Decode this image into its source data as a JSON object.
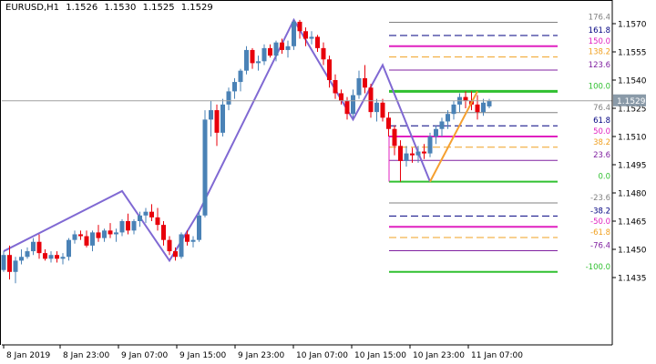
{
  "header": {
    "symbol": "EURUSD,H1",
    "open": "1.1526",
    "high": "1.1530",
    "low": "1.1525",
    "close": "1.1529"
  },
  "colors": {
    "bull": "#4a82b6",
    "bear": "#e8000b",
    "zigzag": "#8069d3",
    "trend": "#f5a030",
    "price_line": "#a0a0a0",
    "level_gray": "#808080",
    "level_navy": "#000080",
    "level_magenta": "#e020c0",
    "level_orange": "#f0a020",
    "level_green": "#30c030",
    "level_purple": "#8020a0",
    "axis": "#000000",
    "price_box": "#8a9aa8"
  },
  "chart_data": {
    "type": "candlestick",
    "symbol": "EURUSD",
    "timeframe": "H1",
    "ylim": [
      1.1432,
      1.1581
    ],
    "y_ticks": [
      "1.1570",
      "1.1555",
      "1.1540",
      "1.1525",
      "1.1510",
      "1.1495",
      "1.1480",
      "1.1465",
      "1.1450",
      "1.1435"
    ],
    "x_ticks": [
      "8 Jan 2019",
      "8 Jan 23:00",
      "9 Jan 07:00",
      "9 Jan 15:00",
      "9 Jan 23:00",
      "10 Jan 07:00",
      "10 Jan 15:00",
      "10 Jan 23:00",
      "11 Jan 07:00"
    ],
    "current_price": "1.1529",
    "candles": [
      {
        "o": 1.1439,
        "h": 1.1449,
        "l": 1.1438,
        "c": 1.1447
      },
      {
        "o": 1.1447,
        "h": 1.1452,
        "l": 1.1434,
        "c": 1.1438
      },
      {
        "o": 1.1438,
        "h": 1.1446,
        "l": 1.1432,
        "c": 1.1444
      },
      {
        "o": 1.1444,
        "h": 1.145,
        "l": 1.1442,
        "c": 1.1446
      },
      {
        "o": 1.1446,
        "h": 1.1451,
        "l": 1.1445,
        "c": 1.1449
      },
      {
        "o": 1.1449,
        "h": 1.1456,
        "l": 1.1447,
        "c": 1.1454
      },
      {
        "o": 1.1454,
        "h": 1.1458,
        "l": 1.1445,
        "c": 1.1448
      },
      {
        "o": 1.1448,
        "h": 1.145,
        "l": 1.1444,
        "c": 1.1445
      },
      {
        "o": 1.1445,
        "h": 1.1449,
        "l": 1.1443,
        "c": 1.1447
      },
      {
        "o": 1.1447,
        "h": 1.1449,
        "l": 1.1443,
        "c": 1.1445
      },
      {
        "o": 1.1445,
        "h": 1.1448,
        "l": 1.1442,
        "c": 1.1446
      },
      {
        "o": 1.1446,
        "h": 1.1456,
        "l": 1.1444,
        "c": 1.1455
      },
      {
        "o": 1.1455,
        "h": 1.146,
        "l": 1.1453,
        "c": 1.1458
      },
      {
        "o": 1.1458,
        "h": 1.146,
        "l": 1.1455,
        "c": 1.1457
      },
      {
        "o": 1.1457,
        "h": 1.146,
        "l": 1.1451,
        "c": 1.1452
      },
      {
        "o": 1.1452,
        "h": 1.146,
        "l": 1.1449,
        "c": 1.1459
      },
      {
        "o": 1.1459,
        "h": 1.1463,
        "l": 1.1454,
        "c": 1.1456
      },
      {
        "o": 1.1456,
        "h": 1.1461,
        "l": 1.1454,
        "c": 1.146
      },
      {
        "o": 1.146,
        "h": 1.1464,
        "l": 1.1456,
        "c": 1.1458
      },
      {
        "o": 1.1458,
        "h": 1.1461,
        "l": 1.1454,
        "c": 1.1459
      },
      {
        "o": 1.1459,
        "h": 1.1466,
        "l": 1.1457,
        "c": 1.1465
      },
      {
        "o": 1.1465,
        "h": 1.1469,
        "l": 1.1458,
        "c": 1.146
      },
      {
        "o": 1.146,
        "h": 1.1466,
        "l": 1.1458,
        "c": 1.1465
      },
      {
        "o": 1.1465,
        "h": 1.147,
        "l": 1.1462,
        "c": 1.1468
      },
      {
        "o": 1.1468,
        "h": 1.1472,
        "l": 1.1464,
        "c": 1.147
      },
      {
        "o": 1.147,
        "h": 1.1474,
        "l": 1.1465,
        "c": 1.1467
      },
      {
        "o": 1.1467,
        "h": 1.1472,
        "l": 1.146,
        "c": 1.1463
      },
      {
        "o": 1.1463,
        "h": 1.1465,
        "l": 1.1452,
        "c": 1.1455
      },
      {
        "o": 1.1455,
        "h": 1.1457,
        "l": 1.1447,
        "c": 1.1449
      },
      {
        "o": 1.1449,
        "h": 1.1451,
        "l": 1.1444,
        "c": 1.1446
      },
      {
        "o": 1.1446,
        "h": 1.1459,
        "l": 1.1445,
        "c": 1.1458
      },
      {
        "o": 1.1458,
        "h": 1.146,
        "l": 1.1452,
        "c": 1.1454
      },
      {
        "o": 1.1454,
        "h": 1.1457,
        "l": 1.1451,
        "c": 1.1455
      },
      {
        "o": 1.1455,
        "h": 1.147,
        "l": 1.1454,
        "c": 1.1468
      },
      {
        "o": 1.1468,
        "h": 1.1524,
        "l": 1.1467,
        "c": 1.1519
      },
      {
        "o": 1.1519,
        "h": 1.1529,
        "l": 1.151,
        "c": 1.1524
      },
      {
        "o": 1.1524,
        "h": 1.1527,
        "l": 1.1505,
        "c": 1.1512
      },
      {
        "o": 1.1512,
        "h": 1.153,
        "l": 1.151,
        "c": 1.1527
      },
      {
        "o": 1.1527,
        "h": 1.1536,
        "l": 1.1524,
        "c": 1.1534
      },
      {
        "o": 1.1534,
        "h": 1.1541,
        "l": 1.153,
        "c": 1.1539
      },
      {
        "o": 1.1539,
        "h": 1.1546,
        "l": 1.1534,
        "c": 1.1545
      },
      {
        "o": 1.1545,
        "h": 1.1558,
        "l": 1.1543,
        "c": 1.1556
      },
      {
        "o": 1.1556,
        "h": 1.1557,
        "l": 1.1546,
        "c": 1.1549
      },
      {
        "o": 1.1549,
        "h": 1.1553,
        "l": 1.1545,
        "c": 1.155
      },
      {
        "o": 1.155,
        "h": 1.1559,
        "l": 1.1548,
        "c": 1.1557
      },
      {
        "o": 1.1557,
        "h": 1.1559,
        "l": 1.1552,
        "c": 1.1553
      },
      {
        "o": 1.1553,
        "h": 1.1561,
        "l": 1.155,
        "c": 1.156
      },
      {
        "o": 1.156,
        "h": 1.1562,
        "l": 1.1554,
        "c": 1.1556
      },
      {
        "o": 1.1556,
        "h": 1.1561,
        "l": 1.1552,
        "c": 1.1558
      },
      {
        "o": 1.1558,
        "h": 1.1572,
        "l": 1.1556,
        "c": 1.1571
      },
      {
        "o": 1.1571,
        "h": 1.1572,
        "l": 1.1562,
        "c": 1.1566
      },
      {
        "o": 1.1566,
        "h": 1.1568,
        "l": 1.1558,
        "c": 1.1562
      },
      {
        "o": 1.1562,
        "h": 1.1566,
        "l": 1.1559,
        "c": 1.1563
      },
      {
        "o": 1.1563,
        "h": 1.1564,
        "l": 1.1555,
        "c": 1.1557
      },
      {
        "o": 1.1557,
        "h": 1.156,
        "l": 1.1548,
        "c": 1.1551
      },
      {
        "o": 1.1551,
        "h": 1.1553,
        "l": 1.1536,
        "c": 1.154
      },
      {
        "o": 1.154,
        "h": 1.1543,
        "l": 1.153,
        "c": 1.1533
      },
      {
        "o": 1.1533,
        "h": 1.1535,
        "l": 1.1527,
        "c": 1.1529
      },
      {
        "o": 1.1529,
        "h": 1.1531,
        "l": 1.1519,
        "c": 1.1522
      },
      {
        "o": 1.1522,
        "h": 1.1535,
        "l": 1.152,
        "c": 1.1532
      },
      {
        "o": 1.1532,
        "h": 1.1545,
        "l": 1.153,
        "c": 1.1541
      },
      {
        "o": 1.1541,
        "h": 1.1548,
        "l": 1.1533,
        "c": 1.1536
      },
      {
        "o": 1.1536,
        "h": 1.1538,
        "l": 1.152,
        "c": 1.1523
      },
      {
        "o": 1.1523,
        "h": 1.153,
        "l": 1.1518,
        "c": 1.1528
      },
      {
        "o": 1.1528,
        "h": 1.153,
        "l": 1.1518,
        "c": 1.152
      },
      {
        "o": 1.152,
        "h": 1.1523,
        "l": 1.151,
        "c": 1.1514
      },
      {
        "o": 1.1514,
        "h": 1.1516,
        "l": 1.15,
        "c": 1.1505
      },
      {
        "o": 1.1505,
        "h": 1.1508,
        "l": 1.1486,
        "c": 1.1497
      },
      {
        "o": 1.1497,
        "h": 1.1505,
        "l": 1.1494,
        "c": 1.1501
      },
      {
        "o": 1.1501,
        "h": 1.1504,
        "l": 1.1496,
        "c": 1.15
      },
      {
        "o": 1.15,
        "h": 1.1505,
        "l": 1.1496,
        "c": 1.1502
      },
      {
        "o": 1.1502,
        "h": 1.1506,
        "l": 1.1498,
        "c": 1.1501
      },
      {
        "o": 1.1501,
        "h": 1.1512,
        "l": 1.1499,
        "c": 1.151
      },
      {
        "o": 1.151,
        "h": 1.1516,
        "l": 1.1506,
        "c": 1.1514
      },
      {
        "o": 1.1514,
        "h": 1.152,
        "l": 1.151,
        "c": 1.1518
      },
      {
        "o": 1.1518,
        "h": 1.1524,
        "l": 1.1514,
        "c": 1.1522
      },
      {
        "o": 1.1522,
        "h": 1.1529,
        "l": 1.1519,
        "c": 1.1527
      },
      {
        "o": 1.1527,
        "h": 1.1533,
        "l": 1.1523,
        "c": 1.1531
      },
      {
        "o": 1.1531,
        "h": 1.1534,
        "l": 1.1525,
        "c": 1.1529
      },
      {
        "o": 1.1529,
        "h": 1.1534,
        "l": 1.1524,
        "c": 1.1527
      },
      {
        "o": 1.1527,
        "h": 1.1532,
        "l": 1.1519,
        "c": 1.1523
      },
      {
        "o": 1.1523,
        "h": 1.153,
        "l": 1.1521,
        "c": 1.1528
      },
      {
        "o": 1.1526,
        "h": 1.153,
        "l": 1.1525,
        "c": 1.1529
      }
    ],
    "zigzag": [
      {
        "i": 0,
        "p": 1.1449
      },
      {
        "i": 20,
        "p": 1.1481
      },
      {
        "i": 28,
        "p": 1.1444
      },
      {
        "i": 33,
        "p": 1.147
      },
      {
        "i": 49,
        "p": 1.1572
      },
      {
        "i": 59,
        "p": 1.1519
      },
      {
        "i": 64,
        "p": 1.1548
      },
      {
        "i": 72,
        "p": 1.1486
      }
    ],
    "trendline": [
      {
        "i": 72,
        "p": 1.1486
      },
      {
        "i": 80,
        "p": 1.1534
      }
    ],
    "fib_levels": [
      {
        "label": "176.4",
        "price": 1.15707,
        "color": "#808080",
        "style": "solid",
        "width": 1
      },
      {
        "label": "161.8",
        "price": 1.15637,
        "color": "#000080",
        "style": "dash",
        "width": 1
      },
      {
        "label": "150.0",
        "price": 1.1558,
        "color": "#e020c0",
        "style": "solid",
        "width": 2
      },
      {
        "label": "138.2",
        "price": 1.15523,
        "color": "#f0a020",
        "style": "dash",
        "width": 1
      },
      {
        "label": "123.6",
        "price": 1.15453,
        "color": "#8020a0",
        "style": "solid",
        "width": 1
      },
      {
        "label": "100.0",
        "price": 1.1534,
        "color": "#30c030",
        "style": "solid",
        "width": 3
      },
      {
        "label": "76.4",
        "price": 1.15227,
        "color": "#808080",
        "style": "solid",
        "width": 1
      },
      {
        "label": "61.8",
        "price": 1.15157,
        "color": "#000080",
        "style": "dash",
        "width": 1
      },
      {
        "label": "50.0",
        "price": 1.151,
        "color": "#e020c0",
        "style": "solid",
        "width": 2
      },
      {
        "label": "38.2",
        "price": 1.15043,
        "color": "#f0a020",
        "style": "dash",
        "width": 1
      },
      {
        "label": "23.6",
        "price": 1.14973,
        "color": "#8020a0",
        "style": "solid",
        "width": 1
      },
      {
        "label": "0.0",
        "price": 1.1486,
        "color": "#30c030",
        "style": "solid",
        "width": 2
      },
      {
        "label": "-23.6",
        "price": 1.14747,
        "color": "#808080",
        "style": "solid",
        "width": 1
      },
      {
        "label": "-38.2",
        "price": 1.14677,
        "color": "#000080",
        "style": "dash",
        "width": 1
      },
      {
        "label": "-50.0",
        "price": 1.1462,
        "color": "#e020c0",
        "style": "solid",
        "width": 2
      },
      {
        "label": "-61.8",
        "price": 1.14563,
        "color": "#f0a020",
        "style": "dash",
        "width": 1
      },
      {
        "label": "-76.4",
        "price": 1.14493,
        "color": "#8020a0",
        "style": "solid",
        "width": 1
      },
      {
        "label": "-100.0",
        "price": 1.1438,
        "color": "#30c030",
        "style": "solid",
        "width": 2
      }
    ],
    "fib_anchor_index": 72,
    "fib_top_segment_price": 1.151
  }
}
